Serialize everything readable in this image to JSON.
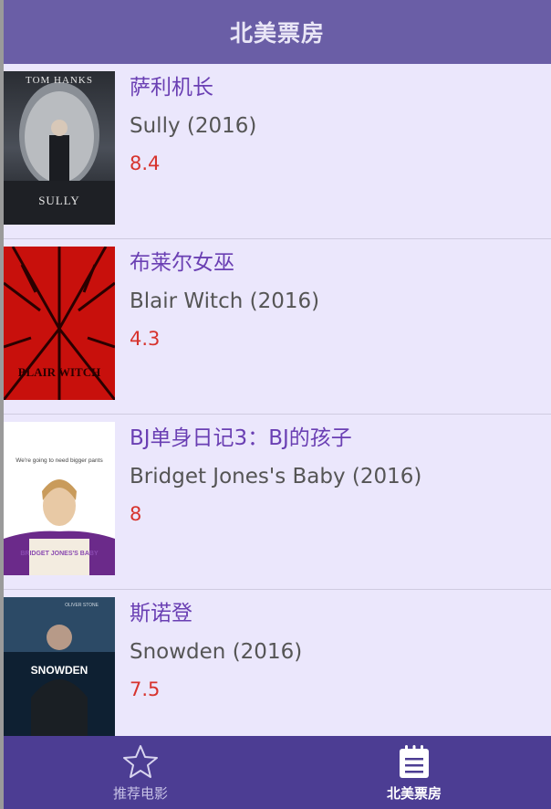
{
  "header": {
    "title": "北美票房"
  },
  "movies": [
    {
      "title_cn": "萨利机长",
      "title_en": "Sully (2016)",
      "rating": "8.4",
      "poster_top": "TOM HANKS",
      "poster_bottom": "SULLY"
    },
    {
      "title_cn": "布莱尔女巫",
      "title_en": "Blair Witch (2016)",
      "rating": "4.3",
      "poster_bottom": "BLAIR WITCH"
    },
    {
      "title_cn": "BJ单身日记3：BJ的孩子",
      "title_en": "Bridget Jones's Baby (2016)",
      "rating": "8",
      "poster_top": "We're going to need bigger pants",
      "poster_bottom": "BRIDGET JONES'S BABY"
    },
    {
      "title_cn": "斯诺登",
      "title_en": "Snowden (2016)",
      "rating": "7.5",
      "poster_top": "OLIVER STONE",
      "poster_bottom": "SNOWDEN"
    }
  ],
  "tabs": [
    {
      "label": "推荐电影",
      "icon": "star-icon",
      "active": false
    },
    {
      "label": "北美票房",
      "icon": "notepad-icon",
      "active": true
    }
  ],
  "colors": {
    "header_bg": "#6a5ea6",
    "tabbar_bg": "#4c3d93",
    "list_bg": "#ebe7fc",
    "title_cn": "#6a3fb3",
    "rating": "#d7332d"
  }
}
